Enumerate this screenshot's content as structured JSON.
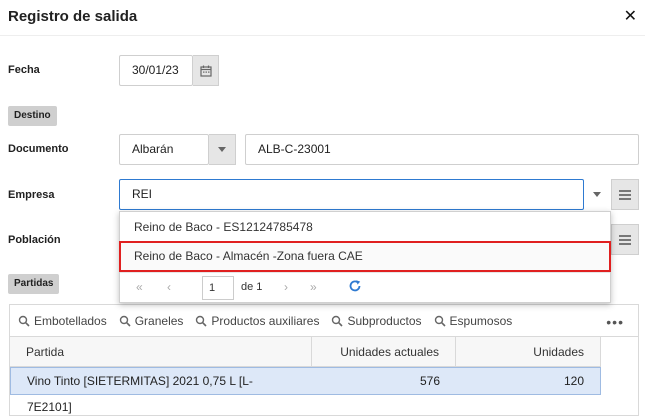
{
  "dialog": {
    "title": "Registro de salida"
  },
  "form": {
    "fecha": {
      "label": "Fecha",
      "value": "30/01/23"
    },
    "destino_section": "Destino",
    "documento": {
      "label": "Documento",
      "type_value": "Albarán",
      "number_value": "ALB-C-23001"
    },
    "empresa": {
      "label": "Empresa",
      "value": "REI"
    },
    "poblacion": {
      "label": "Población"
    },
    "partidas_section": "Partidas"
  },
  "dropdown": {
    "options": [
      {
        "label": "Reino de Baco - ES12124785478"
      },
      {
        "label": "Reino de Baco - Almacén -Zona fuera CAE"
      }
    ],
    "pager": {
      "page": "1",
      "of_text": "de 1"
    }
  },
  "toolbar": {
    "buttons": [
      "Embotellados",
      "Graneles",
      "Productos auxiliares",
      "Subproductos",
      "Espumosos"
    ]
  },
  "table": {
    "columns": [
      "Partida",
      "Unidades actuales",
      "Unidades"
    ],
    "rows": [
      {
        "partida": "Vino Tinto [SIETERMITAS] 2021 0,75 L [L-7E2101]",
        "unidades_actuales": "576",
        "unidades": "120"
      }
    ]
  },
  "colors": {
    "accent": "#2e7ad1",
    "highlight_border": "#e02020",
    "selected_row": "#dde8f8",
    "chip_bg": "#cfcfcf"
  }
}
